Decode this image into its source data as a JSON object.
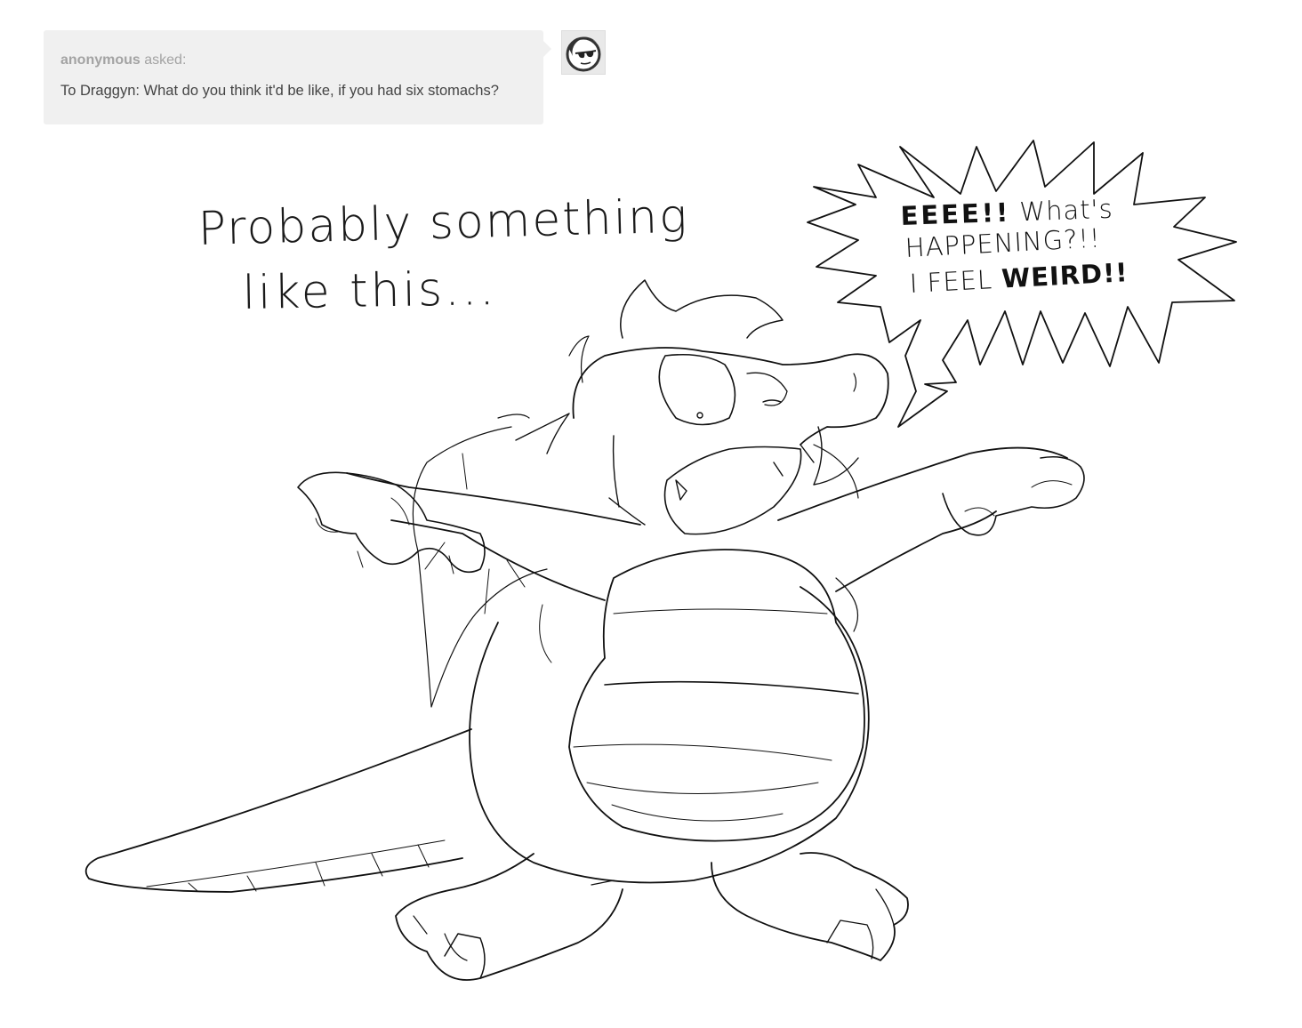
{
  "ask": {
    "asker": "anonymous",
    "verb": "asked:",
    "question": "To Draggyn: What do you think it'd be like, if you had six stomachs?"
  },
  "avatar": {
    "icon": "sunglasses-face-icon"
  },
  "art": {
    "caption_line1": "Probably something",
    "caption_line2": "like this...",
    "speech_exclaim": "EEEE!!",
    "speech_line1_rest": "What's",
    "speech_line2": "HAPPENING?!!",
    "speech_line3_start": "I FEEL",
    "speech_line3_end": "WEIRD!!"
  },
  "colors": {
    "ask_background": "#f0f0f0",
    "asker_text": "#a3a3a3",
    "question_text": "#444444",
    "ink": "#1a1a1a"
  }
}
